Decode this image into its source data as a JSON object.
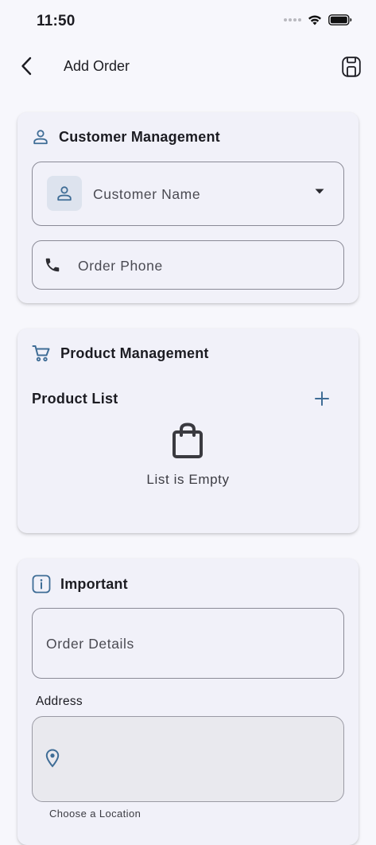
{
  "status_bar": {
    "time": "11:50"
  },
  "app_bar": {
    "title": "Add Order"
  },
  "customer_card": {
    "title": "Customer Management",
    "customer_name_placeholder": "Customer Name",
    "order_phone_placeholder": "Order Phone"
  },
  "product_card": {
    "title": "Product Management",
    "product_list_label": "Product List",
    "empty_text": "List is Empty"
  },
  "important_card": {
    "title": "Important",
    "order_details_placeholder": "Order Details",
    "address_label": "Address",
    "choose_location": "Choose a Location"
  },
  "colors": {
    "accent": "#3f6d96",
    "background": "#f7f7fc",
    "card": "#f1f1f9"
  }
}
